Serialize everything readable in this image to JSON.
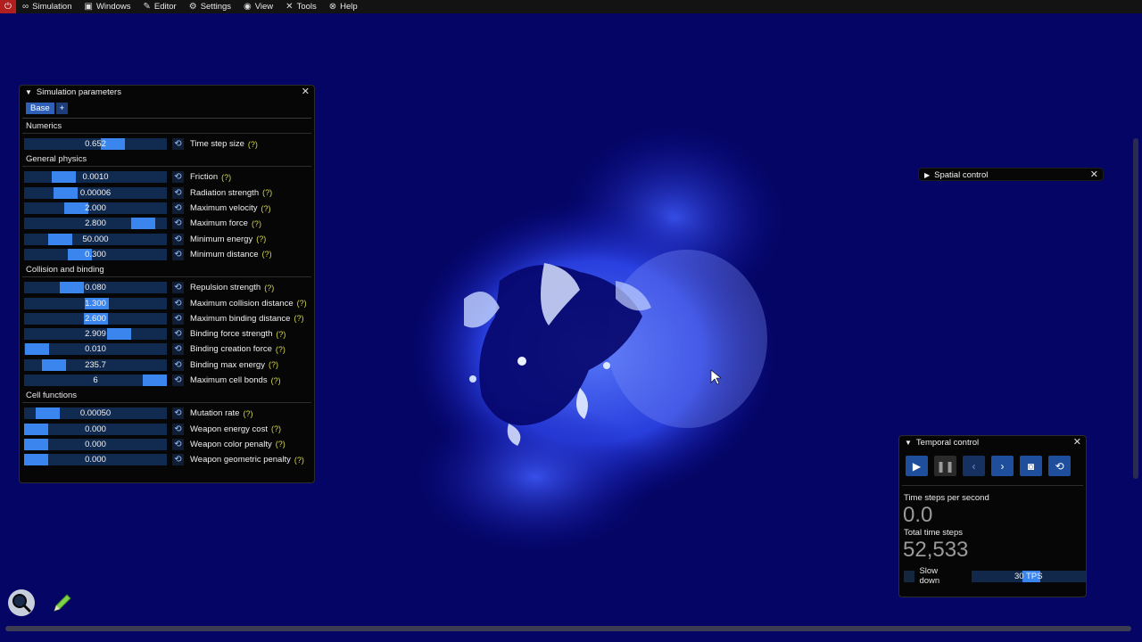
{
  "menu": {
    "items": [
      {
        "label": "Simulation",
        "icon": "glasses-icon",
        "glyph": "∞"
      },
      {
        "label": "Windows",
        "icon": "window-icon",
        "glyph": "▣"
      },
      {
        "label": "Editor",
        "icon": "pencil-icon",
        "glyph": "✎"
      },
      {
        "label": "Settings",
        "icon": "gear-icon",
        "glyph": "⚙"
      },
      {
        "label": "View",
        "icon": "eye-icon",
        "glyph": "◉"
      },
      {
        "label": "Tools",
        "icon": "tools-icon",
        "glyph": "✕"
      },
      {
        "label": "Help",
        "icon": "help-icon",
        "glyph": "⊗"
      }
    ]
  },
  "sim_params": {
    "title": "Simulation parameters",
    "tabs": {
      "base": "Base",
      "add": "+"
    },
    "help_mark": "(?)",
    "sections": [
      {
        "title": "Numerics",
        "rows": [
          {
            "value": "0.652",
            "label": "Time step size",
            "fill": 0.65
          }
        ]
      },
      {
        "title": "General physics",
        "rows": [
          {
            "value": "0.0010",
            "label": "Friction",
            "fill": 0.23
          },
          {
            "value": "0.00006",
            "label": "Radiation strength",
            "fill": 0.25
          },
          {
            "value": "2.000",
            "label": "Maximum velocity",
            "fill": 0.34
          },
          {
            "value": "2.800",
            "label": "Maximum force",
            "fill": 0.9
          },
          {
            "value": "50.000",
            "label": "Minimum energy",
            "fill": 0.2
          },
          {
            "value": "0.300",
            "label": "Minimum distance",
            "fill": 0.37
          }
        ]
      },
      {
        "title": "Collision and binding",
        "rows": [
          {
            "value": "0.080",
            "label": "Repulsion strength",
            "fill": 0.3
          },
          {
            "value": "1.300",
            "label": "Maximum collision distance",
            "fill": 0.51
          },
          {
            "value": "2.600",
            "label": "Maximum binding distance",
            "fill": 0.5
          },
          {
            "value": "2.909",
            "label": "Binding force strength",
            "fill": 0.7
          },
          {
            "value": "0.010",
            "label": "Binding creation force",
            "fill": 0.01
          },
          {
            "value": "235.7",
            "label": "Binding max energy",
            "fill": 0.15
          },
          {
            "value": "6",
            "label": "Maximum cell bonds",
            "fill": 1.0
          }
        ]
      },
      {
        "title": "Cell functions",
        "rows": [
          {
            "value": "0.00050",
            "label": "Mutation rate",
            "fill": 0.1
          },
          {
            "value": "0.000",
            "label": "Weapon energy cost",
            "fill": 0.0
          },
          {
            "value": "0.000",
            "label": "Weapon color penalty",
            "fill": 0.0
          },
          {
            "value": "0.000",
            "label": "Weapon geometric penalty",
            "fill": 0.0
          }
        ]
      }
    ]
  },
  "spatial": {
    "title": "Spatial control"
  },
  "temporal": {
    "title": "Temporal control",
    "tps_label": "Time steps per second",
    "tps_value": "0.0",
    "total_label": "Total time steps",
    "total_value": "52,533",
    "slow_label": "Slow down",
    "slow_value": "30 TPS"
  },
  "colors": {
    "accent": "#3a86ee",
    "background": "#050565",
    "panel": "#060606"
  }
}
